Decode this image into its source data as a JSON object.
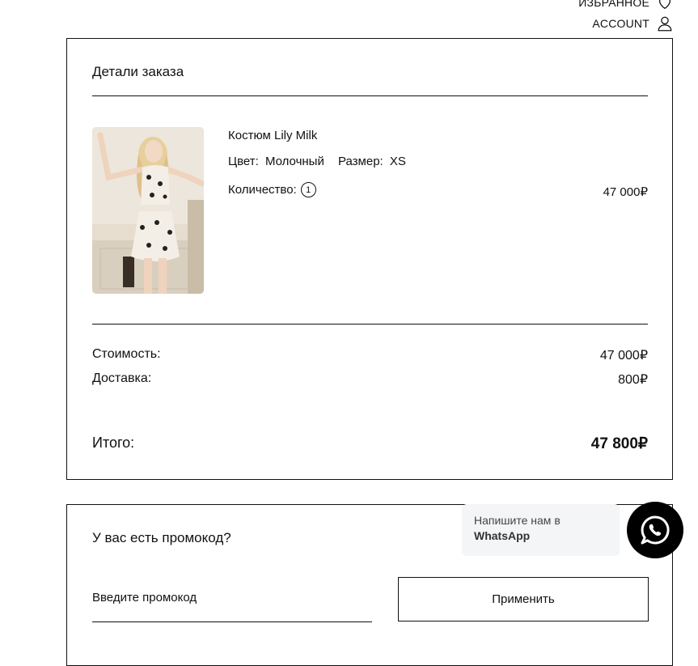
{
  "header": {
    "favorites_label": "ИЗБРАННОЕ",
    "account_label": "ACCOUNT"
  },
  "order": {
    "title": "Детали заказа",
    "item": {
      "name": "Костюм Lily Milk",
      "color_label": "Цвет:",
      "color_value": "Молочный",
      "size_label": "Размер:",
      "size_value": "XS",
      "quantity_label": "Количество:",
      "quantity_value": "1",
      "price": "47 000₽"
    },
    "cost_label": "Стоимость:",
    "cost_value": "47 000₽",
    "delivery_label": "Доставка:",
    "delivery_value": "800₽",
    "total_label": "Итого:",
    "total_value": "47 800₽"
  },
  "promo": {
    "title": "У вас есть промокод?",
    "input_placeholder": "Введите промокод",
    "apply_label": "Применить"
  },
  "whatsapp": {
    "line1": "Напишите нам в",
    "line2": "WhatsApp"
  }
}
